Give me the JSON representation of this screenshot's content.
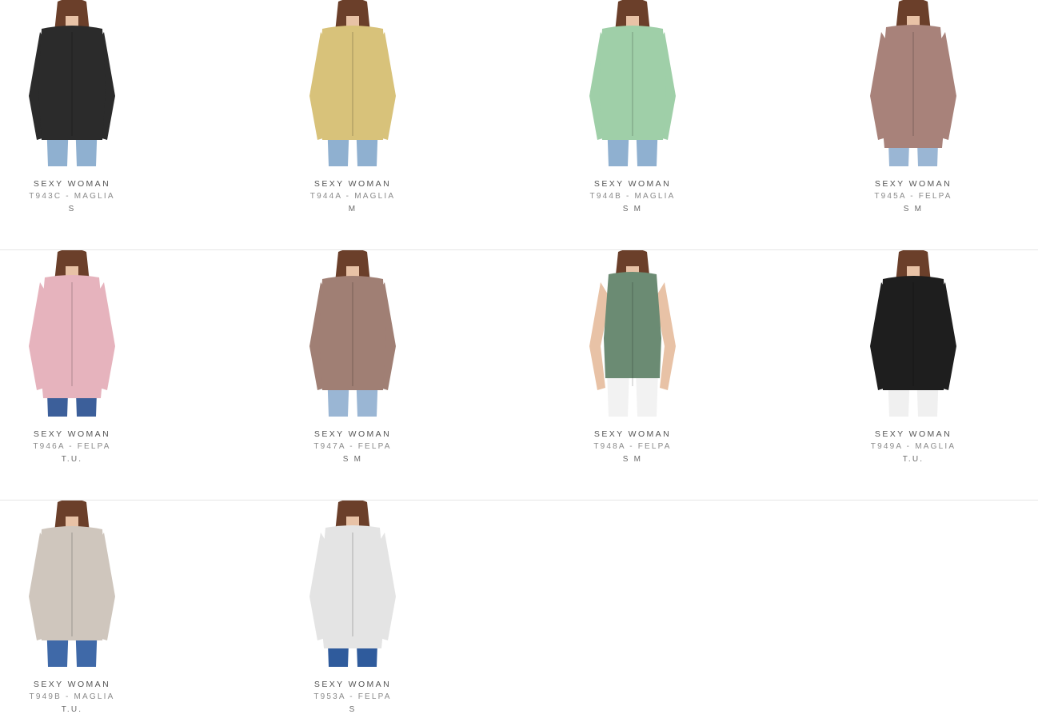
{
  "brand_color": "#555555",
  "code_color": "#8a8a8a",
  "products": [
    {
      "brand": "SEXY WOMAN",
      "code": "T943C - MAGLIA",
      "sizes": "S",
      "garment": "#2b2b2b",
      "garment_style": "top",
      "pants": "#8fb0d0",
      "skin": "#e8c2a6"
    },
    {
      "brand": "SEXY WOMAN",
      "code": "T944A - MAGLIA",
      "sizes": "M",
      "garment": "#d8c27a",
      "garment_style": "top",
      "pants": "#8fb0d0",
      "skin": "#e8c2a6"
    },
    {
      "brand": "SEXY WOMAN",
      "code": "T944B - MAGLIA",
      "sizes": "S M",
      "garment": "#9fcfa8",
      "garment_style": "top",
      "pants": "#8fb0d0",
      "skin": "#e8c2a6"
    },
    {
      "brand": "SEXY WOMAN",
      "code": "T945A - FELPA",
      "sizes": "S M",
      "garment": "#a8827a",
      "garment_style": "cardigan",
      "pants": "#9ab6d4",
      "skin": "#e8c2a6"
    },
    {
      "brand": "SEXY WOMAN",
      "code": "T946A - FELPA",
      "sizes": "T.U.",
      "garment": "#e6b3bd",
      "garment_style": "cardigan",
      "pants": "#3c5f9a",
      "skin": "#e8c2a6"
    },
    {
      "brand": "SEXY WOMAN",
      "code": "T947A - FELPA",
      "sizes": "S M",
      "garment": "#a07f74",
      "garment_style": "top",
      "pants": "#9ab6d4",
      "skin": "#e8c2a6"
    },
    {
      "brand": "SEXY WOMAN",
      "code": "T948A - FELPA",
      "sizes": "S M",
      "garment": "#6b8b73",
      "garment_style": "vest",
      "pants": "#f2f2f2",
      "skin": "#e8c2a6"
    },
    {
      "brand": "SEXY WOMAN",
      "code": "T949A - MAGLIA",
      "sizes": "T.U.",
      "garment": "#1e1e1e",
      "garment_style": "top",
      "pants": "#f0f0f0",
      "skin": "#e8c2a6"
    },
    {
      "brand": "SEXY WOMAN",
      "code": "T949B - MAGLIA",
      "sizes": "T.U.",
      "garment": "#cfc6bd",
      "garment_style": "top",
      "pants": "#3f69a8",
      "skin": "#e8c2a6"
    },
    {
      "brand": "SEXY WOMAN",
      "code": "T953A - FELPA",
      "sizes": "S",
      "garment": "#e4e4e4",
      "garment_style": "cardigan",
      "pants": "#2f5b9c",
      "skin": "#e8c2a6"
    }
  ]
}
